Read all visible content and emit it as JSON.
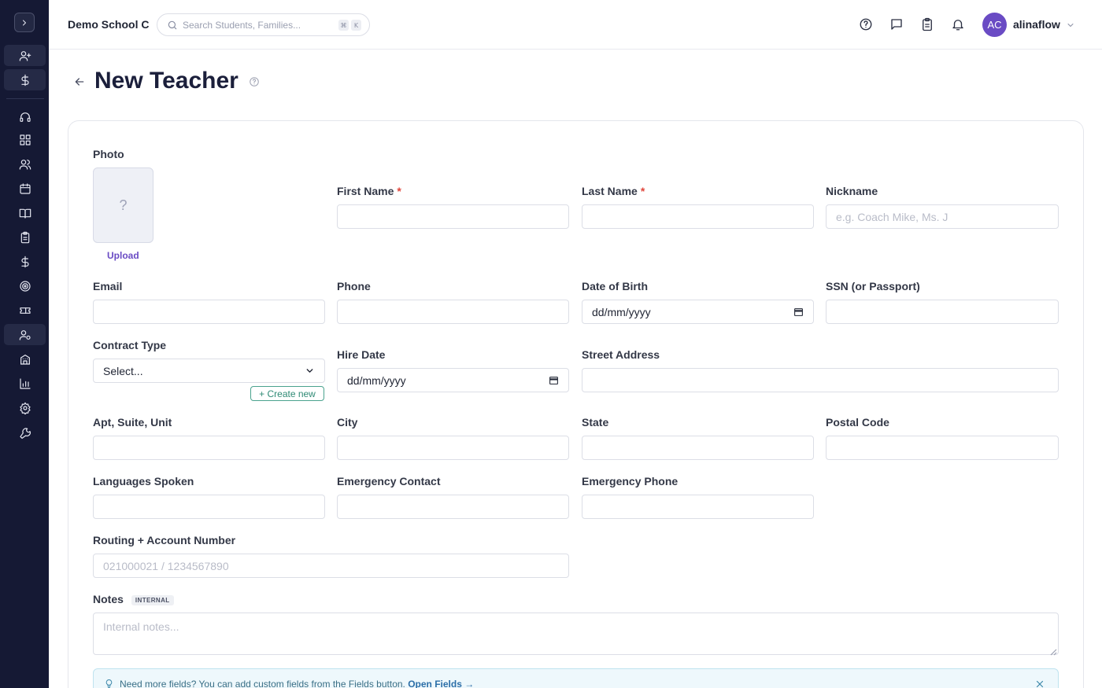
{
  "app": {
    "school_name": "Demo School C",
    "search": {
      "placeholder": "Search Students, Families...",
      "shortcut_mod": "⌘",
      "shortcut_key": "K"
    },
    "user": {
      "initials": "AC",
      "name": "alinaflow"
    },
    "accent_color": "#6a4bc4"
  },
  "sidebar": {
    "icons": [
      "chevron-right-icon",
      "user-plus-icon",
      "dollar-icon",
      "headset-icon",
      "grid-icon",
      "users-icon",
      "calendar-icon",
      "book-icon",
      "clipboard-icon",
      "dollar-icon",
      "target-icon",
      "ticket-icon",
      "user-gear-icon",
      "building-icon",
      "bar-chart-icon",
      "settings-icon",
      "wrench-icon"
    ],
    "active_item": "user-gear-icon"
  },
  "page": {
    "title": "New Teacher"
  },
  "form": {
    "photo": {
      "label": "Photo",
      "placeholder_glyph": "?",
      "upload": "Upload"
    },
    "first_name": {
      "label": "First Name",
      "required": "*",
      "value": ""
    },
    "last_name": {
      "label": "Last Name",
      "required": "*",
      "value": ""
    },
    "nickname": {
      "label": "Nickname",
      "placeholder": "e.g. Coach Mike, Ms. J"
    },
    "email": {
      "label": "Email",
      "value": ""
    },
    "phone": {
      "label": "Phone",
      "value": ""
    },
    "date_of_birth": {
      "label": "Date of Birth",
      "value": "dd/mm/yyyy"
    },
    "ssn": {
      "label": "SSN (or Passport)",
      "value": ""
    },
    "contract_type": {
      "label": "Contract Type",
      "value": "Select...",
      "create_new": "+ Create new"
    },
    "hire_date": {
      "label": "Hire Date",
      "value": "dd/mm/yyyy"
    },
    "street_address": {
      "label": "Street Address",
      "value": ""
    },
    "apt": {
      "label": "Apt, Suite, Unit",
      "value": ""
    },
    "city": {
      "label": "City",
      "value": ""
    },
    "state": {
      "label": "State",
      "value": ""
    },
    "postal_code": {
      "label": "Postal Code",
      "value": ""
    },
    "languages": {
      "label": "Languages Spoken",
      "value": ""
    },
    "emergency_contact": {
      "label": "Emergency Contact",
      "value": ""
    },
    "emergency_phone": {
      "label": "Emergency Phone",
      "value": ""
    },
    "routing": {
      "label": "Routing + Account Number",
      "placeholder": "021000021 / 1234567890"
    },
    "notes": {
      "label": "Notes",
      "badge": "INTERNAL",
      "placeholder": "Internal notes..."
    }
  },
  "tip": {
    "text": "Need more fields? You can add custom fields from the Fields button.",
    "link": "Open Fields →"
  }
}
